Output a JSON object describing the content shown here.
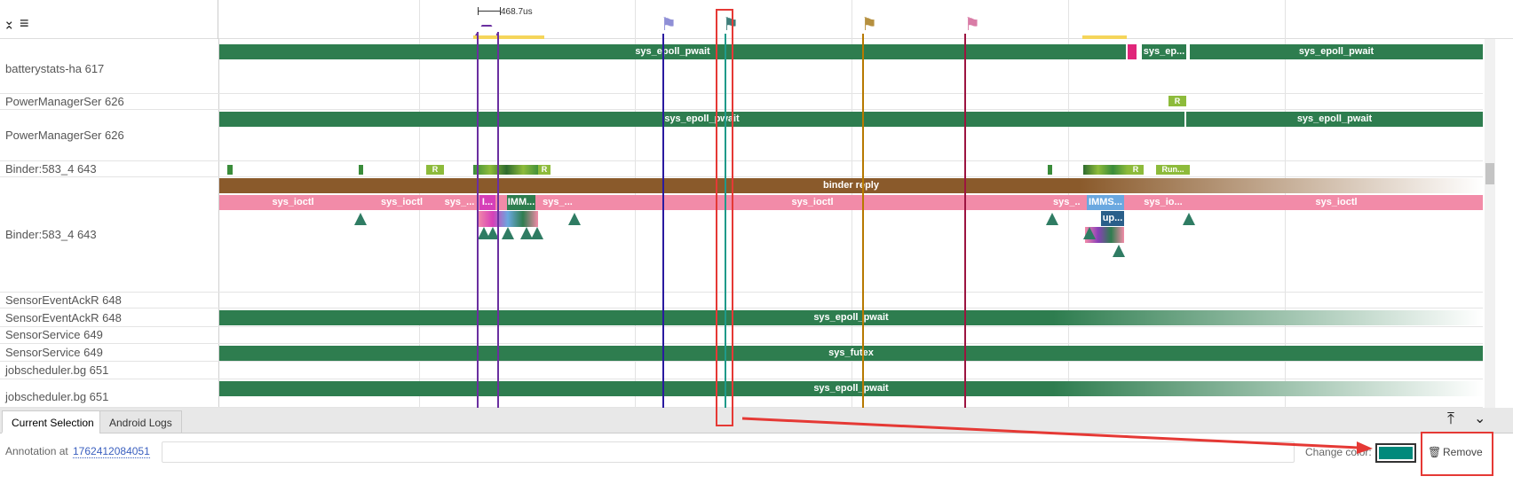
{
  "ruler": {
    "area_label_value": "468.7us",
    "expand_label": "⌄",
    "menu_label": "≡"
  },
  "tracks": [
    {
      "name": "batterystats-ha 617"
    },
    {
      "name": "PowerManagerSer 626"
    },
    {
      "name": "PowerManagerSer 626"
    },
    {
      "name": "Binder:583_4 643"
    },
    {
      "name": "Binder:583_4 643"
    },
    {
      "name": "SensorEventAckR 648"
    },
    {
      "name": "SensorEventAckR 648"
    },
    {
      "name": "SensorService 649"
    },
    {
      "name": "SensorService 649"
    },
    {
      "name": "jobscheduler.bg 651"
    },
    {
      "name": "jobscheduler.bg 651"
    }
  ],
  "slices": {
    "battery_main": "sys_epoll_pwait",
    "battery_small": "sys_ep...",
    "battery_right": "sys_epoll_pwait",
    "pm_state": "R",
    "pm_left": "sys_epoll_pwait",
    "pm_right": "sys_epoll_pwait",
    "binder_state_r1": "R",
    "binder_state_r2": "R",
    "binder_state_r3": "R",
    "binder_state_run": "Run...",
    "binder_reply": "binder reply",
    "ioctl_1": "sys_ioctl",
    "ioctl_2": "sys_ioctl",
    "ioctl_3": "sys_...",
    "ioctl_4": "I...",
    "ioctl_5": "IMM...",
    "ioctl_6": "sys_...",
    "ioctl_7": "sys_ioctl",
    "ioctl_8": "sys_...",
    "ioctl_9": "IMMS...",
    "ioctl_10": "sys_io...",
    "ioctl_11": "sys_ioctl",
    "ioctl_12": "up...",
    "sensor_ack": "sys_epoll_pwait",
    "sensor_service": "sys_futex",
    "jobscheduler": "sys_epoll_pwait"
  },
  "tabs": [
    {
      "label": "Current Selection",
      "active": true
    },
    {
      "label": "Android Logs",
      "active": false
    }
  ],
  "details": {
    "annotation_prefix": "Annotation at",
    "annotation_timestamp": "1762412084051",
    "annotation_input_value": "",
    "change_color_label": "Change color:",
    "selected_color": "#00897b",
    "remove_label": "Remove"
  },
  "flags": [
    {
      "color": "#8f8fd6",
      "icon": "flag-icon"
    },
    {
      "color": "#3f7e7a",
      "icon": "flag-icon"
    },
    {
      "color": "#b6903f",
      "icon": "flag-icon"
    },
    {
      "color": "#d97ca6",
      "icon": "flag-icon"
    }
  ],
  "markers": [
    {
      "color": "#2a1aa0"
    },
    {
      "color": "#1f9a8a"
    },
    {
      "color": "#b77900"
    },
    {
      "color": "#9c1440"
    }
  ],
  "colors": {
    "slice_green": "#2e7d4f",
    "slice_pink": "#f28ba8",
    "binder_reply": "#8a5a2b",
    "highlight_red": "#e53935"
  }
}
